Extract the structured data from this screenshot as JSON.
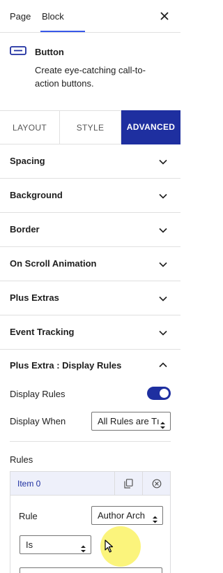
{
  "top_tabs": {
    "page": "Page",
    "block": "Block"
  },
  "block": {
    "title": "Button",
    "description": "Create eye-catching call-to-action buttons.",
    "icon": "button-icon"
  },
  "style_tabs": {
    "layout": "LAYOUT",
    "style": "STYLE",
    "advanced": "ADVANCED"
  },
  "panels": [
    {
      "title": "Spacing"
    },
    {
      "title": "Background"
    },
    {
      "title": "Border"
    },
    {
      "title": "On Scroll Animation"
    },
    {
      "title": "Plus Extras"
    },
    {
      "title": "Event Tracking"
    }
  ],
  "display_rules": {
    "title": "Plus Extra : Display Rules",
    "toggle_label": "Display Rules",
    "toggle_on": true,
    "display_when_label": "Display When",
    "display_when_value": "All Rules are Tı",
    "rules_label": "Rules",
    "item_label": "Item 0",
    "rule_label": "Rule",
    "rule_value": "Author Arch",
    "operator_value": "Is"
  },
  "colors": {
    "accent": "#1e2fa0",
    "toggle": "#1e2fa0",
    "item_header": "#eef0fa"
  }
}
